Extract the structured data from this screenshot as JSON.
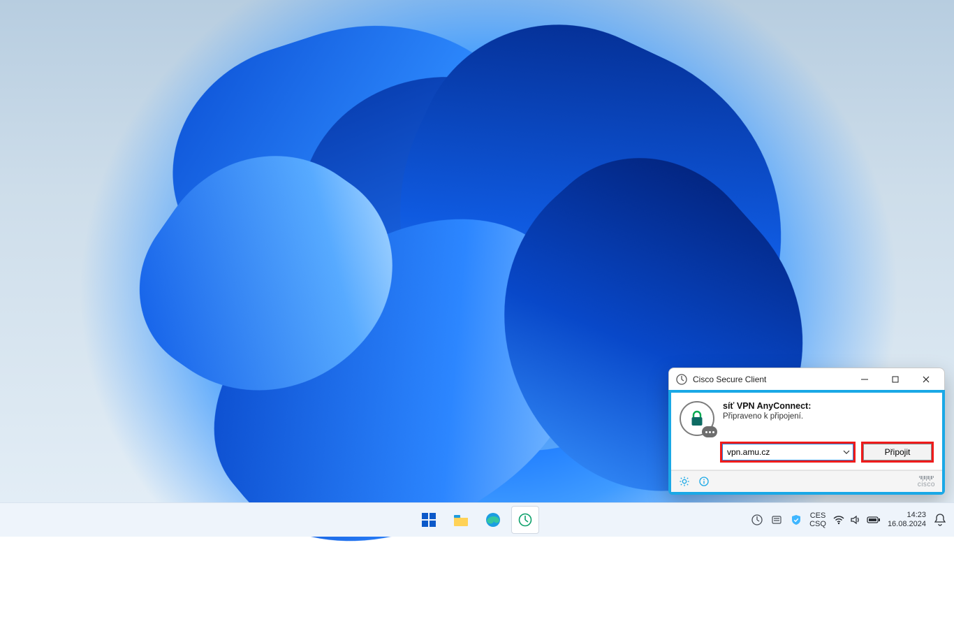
{
  "window": {
    "title": "Cisco Secure Client",
    "section_title": "síť VPN AnyConnect:",
    "status": "Připraveno k připojení.",
    "server_value": "vpn.amu.cz",
    "connect_label": "Připojit",
    "brand": "cisco"
  },
  "taskbar": {
    "lang_top": "CES",
    "lang_bottom": "CSQ",
    "time": "14:23",
    "date": "16.08.2024"
  }
}
